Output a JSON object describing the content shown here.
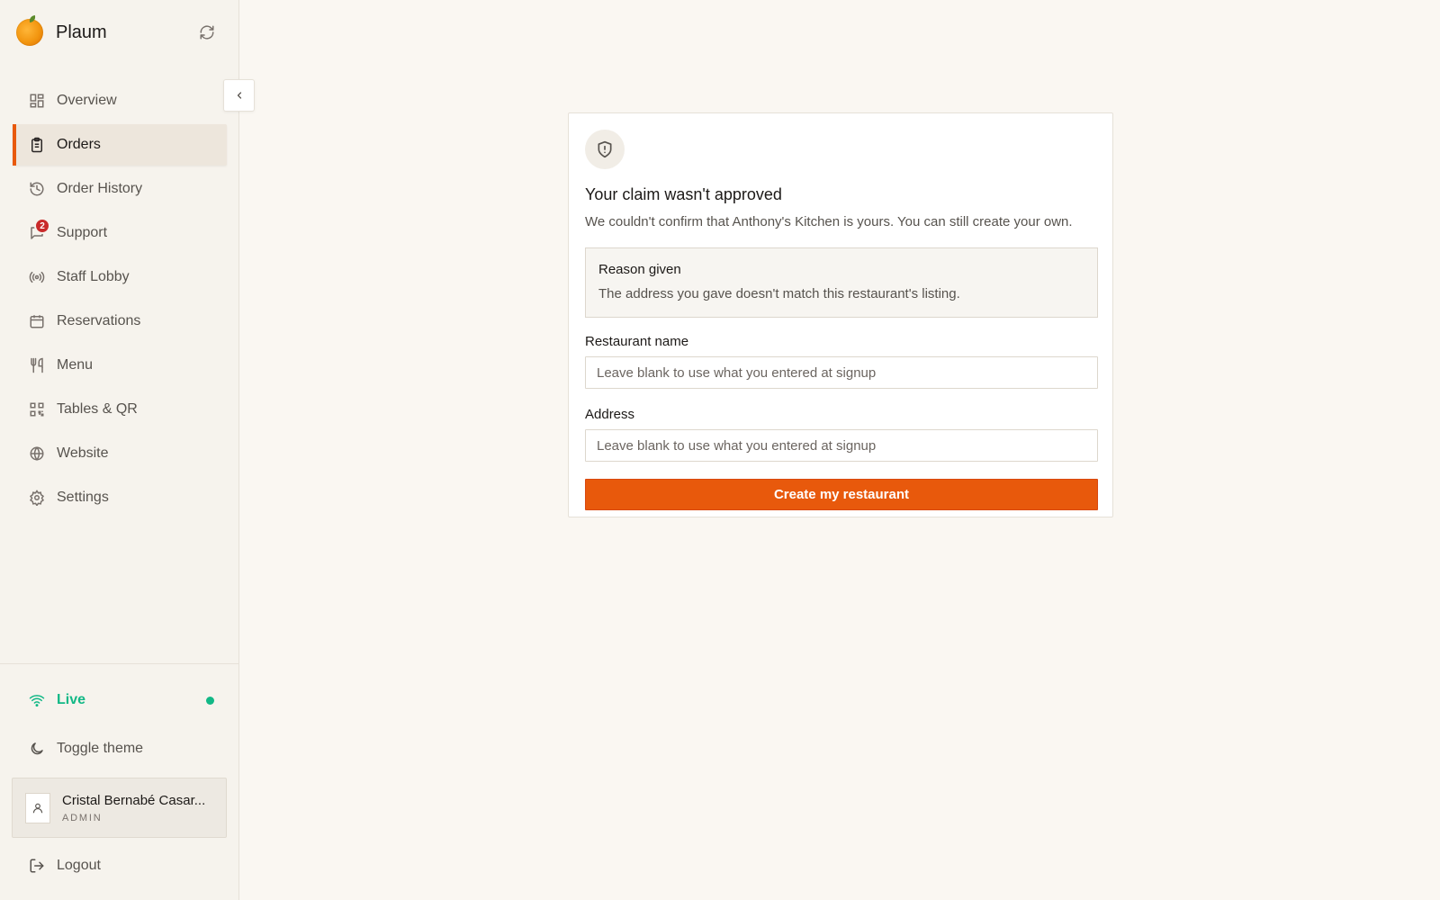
{
  "app": {
    "name": "Plaum"
  },
  "sidebar": {
    "items": [
      {
        "label": "Overview",
        "icon": "dashboard-icon",
        "active": false
      },
      {
        "label": "Orders",
        "icon": "clipboard-icon",
        "active": true
      },
      {
        "label": "Order History",
        "icon": "history-icon",
        "active": false
      },
      {
        "label": "Support",
        "icon": "chat-icon",
        "active": false,
        "badge": "2"
      },
      {
        "label": "Staff Lobby",
        "icon": "broadcast-icon",
        "active": false
      },
      {
        "label": "Reservations",
        "icon": "calendar-icon",
        "active": false
      },
      {
        "label": "Menu",
        "icon": "utensils-icon",
        "active": false
      },
      {
        "label": "Tables & QR",
        "icon": "qr-code-icon",
        "active": false
      },
      {
        "label": "Website",
        "icon": "globe-icon",
        "active": false
      },
      {
        "label": "Settings",
        "icon": "gear-icon",
        "active": false
      }
    ],
    "status": {
      "label": "Live",
      "color": "#12b886"
    },
    "theme_toggle": "Toggle theme",
    "user": {
      "name": "Cristal Bernabé Casar...",
      "role": "ADMIN"
    },
    "logout": "Logout"
  },
  "card": {
    "title": "Your claim wasn't approved",
    "description": "We couldn't confirm that Anthony's Kitchen is yours. You can still create your own.",
    "reason": {
      "title": "Reason given",
      "text": "The address you gave doesn't match this restaurant's listing."
    },
    "fields": {
      "name": {
        "label": "Restaurant name",
        "placeholder": "Leave blank to use what you entered at signup",
        "value": ""
      },
      "address": {
        "label": "Address",
        "placeholder": "Leave blank to use what you entered at signup",
        "value": ""
      }
    },
    "submit_label": "Create my restaurant"
  },
  "colors": {
    "accent": "#e8590c",
    "live": "#12b886",
    "badge": "#c92a2a"
  }
}
